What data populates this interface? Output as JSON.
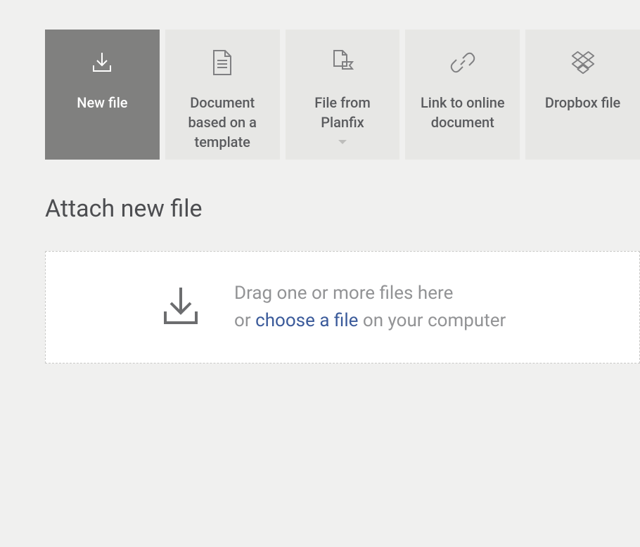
{
  "tabs": [
    {
      "label": "New file",
      "active": true
    },
    {
      "label": "Document based on a template",
      "active": false
    },
    {
      "label": "File from Planfix",
      "active": false,
      "hasDropdown": true
    },
    {
      "label": "Link to online document",
      "active": false
    },
    {
      "label": "Dropbox file",
      "active": false
    }
  ],
  "heading": "Attach new file",
  "dropzone": {
    "line1": "Drag one or more files here",
    "or": "or ",
    "link": "choose a file",
    "rest": " on your computer"
  },
  "colors": {
    "activeTab": "#80807f",
    "inactiveTab": "#e7e7e5",
    "link": "#3a5a9a"
  }
}
